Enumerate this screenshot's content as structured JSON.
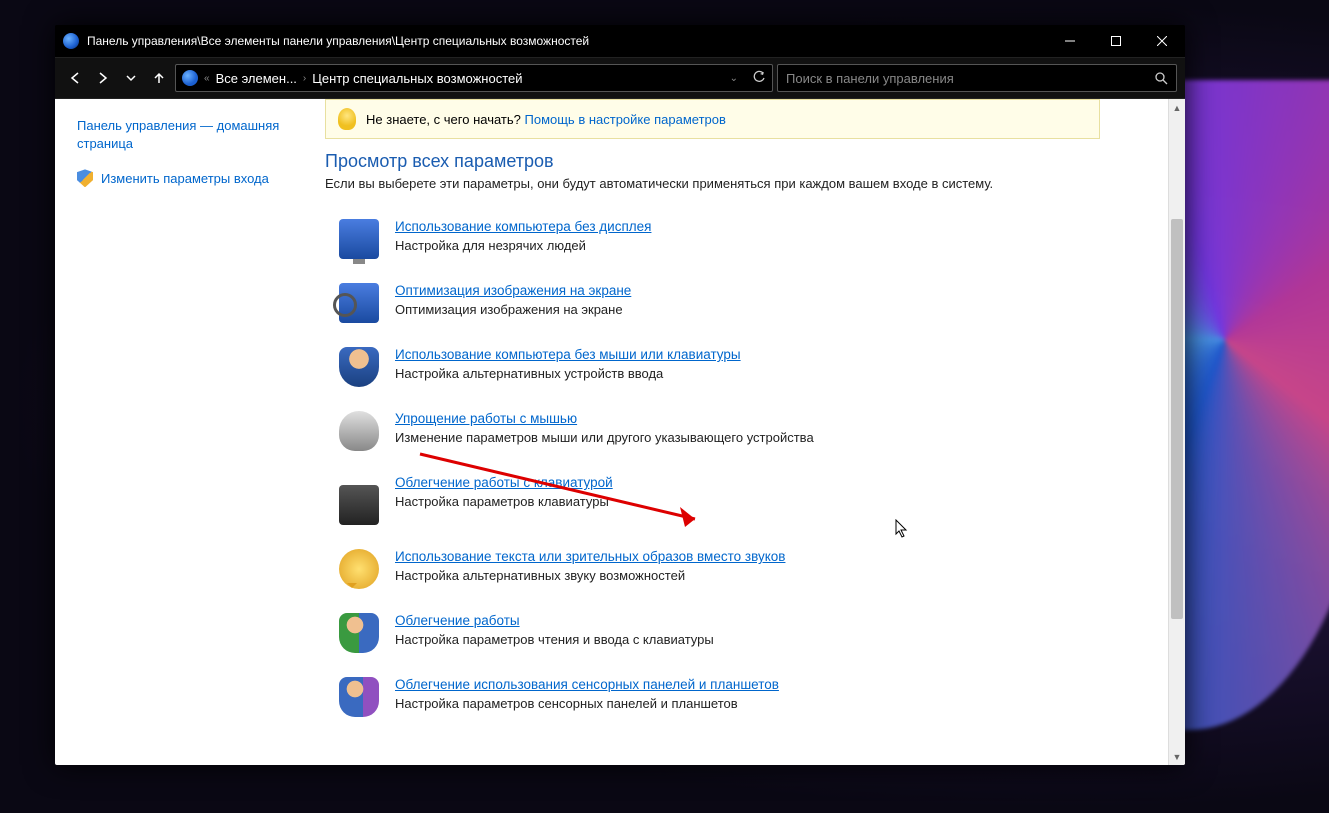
{
  "titlebar": {
    "path": "Панель управления\\Все элементы панели управления\\Центр специальных возможностей"
  },
  "addressbar": {
    "seg1": "Все элемен...",
    "seg2": "Центр специальных возможностей"
  },
  "search": {
    "placeholder": "Поиск в панели управления"
  },
  "sidebar": {
    "home": "Панель управления — домашняя страница",
    "login_params": "Изменить параметры входа"
  },
  "hint": {
    "question": "Не знаете, с чего начать?",
    "link": "Помощь в настройке параметров"
  },
  "section": {
    "title": "Просмотр всех параметров",
    "subtitle": "Если вы выберете эти параметры, они будут автоматически применяться при каждом вашем входе в систему."
  },
  "options": [
    {
      "title": "Использование компьютера без дисплея",
      "desc": "Настройка для незрячих людей"
    },
    {
      "title": "Оптимизация изображения на экране",
      "desc": "Оптимизация изображения на экране"
    },
    {
      "title": "Использование компьютера без мыши или клавиатуры",
      "desc": "Настройка альтернативных устройств ввода"
    },
    {
      "title": "Упрощение работы с мышью",
      "desc": "Изменение параметров мыши или другого указывающего устройства"
    },
    {
      "title": "Облегчение работы с клавиатурой",
      "desc": "Настройка параметров клавиатуры"
    },
    {
      "title": "Использование текста или зрительных образов вместо звуков",
      "desc": "Настройка альтернативных звуку возможностей"
    },
    {
      "title": "Облегчение работы",
      "desc": "Настройка параметров чтения и ввода с клавиатуры"
    },
    {
      "title": "Облегчение использования сенсорных панелей и планшетов",
      "desc": "Настройка параметров сенсорных панелей и планшетов"
    }
  ]
}
